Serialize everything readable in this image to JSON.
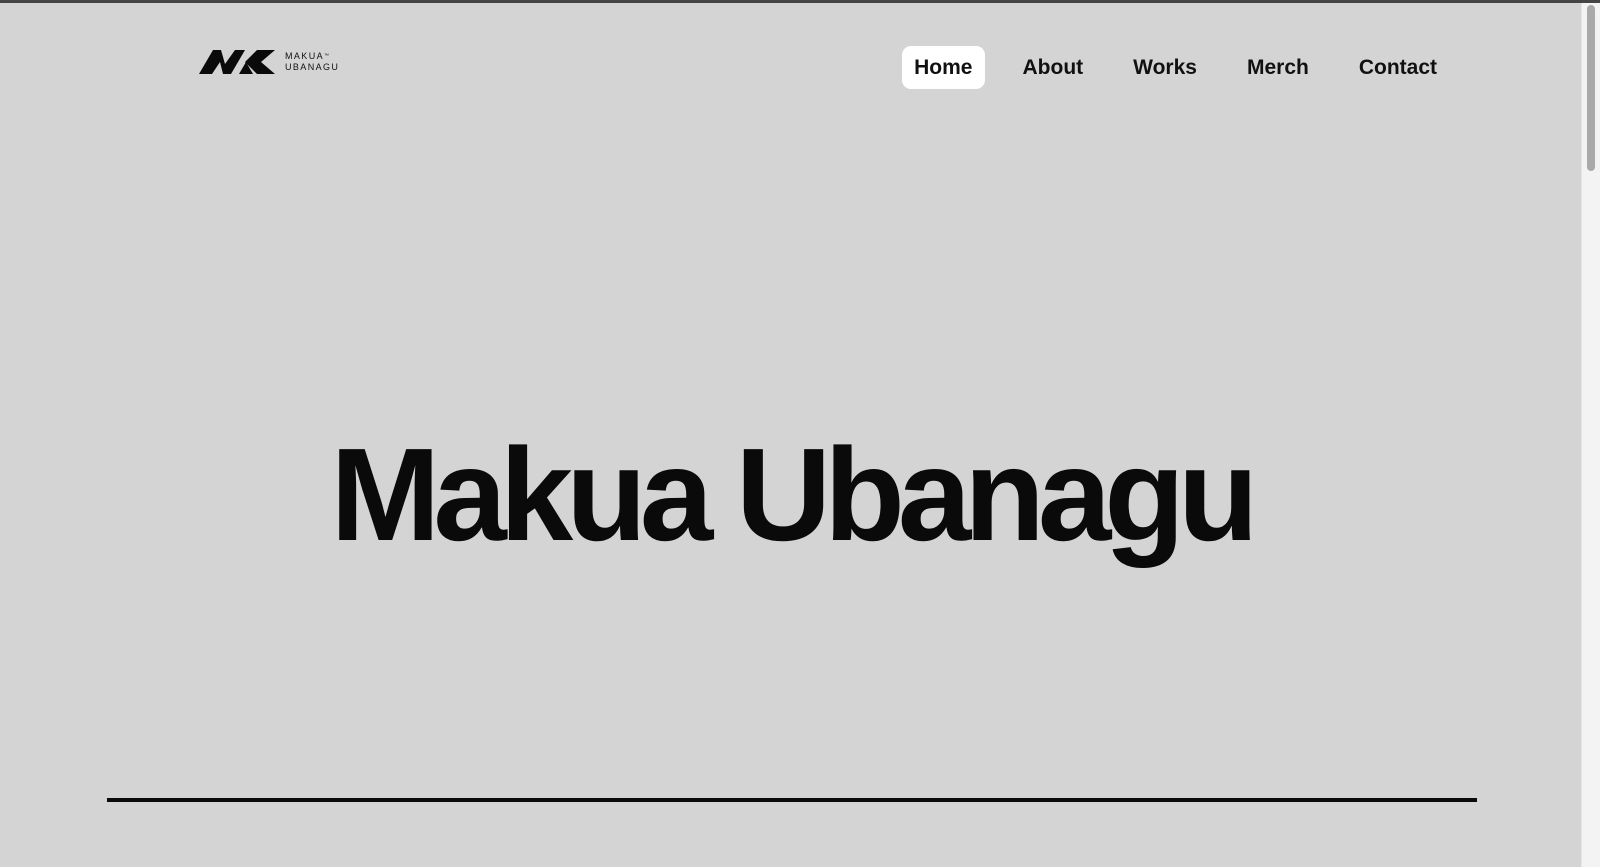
{
  "brand": {
    "mark": "MK",
    "line1": "MAKUA",
    "trademark": "™",
    "line2": "UBANAGU"
  },
  "nav": {
    "items": [
      {
        "label": "Home",
        "active": true
      },
      {
        "label": "About",
        "active": false
      },
      {
        "label": "Works",
        "active": false
      },
      {
        "label": "Merch",
        "active": false
      },
      {
        "label": "Contact",
        "active": false
      }
    ]
  },
  "hero": {
    "title": "Makua Ubanagu"
  },
  "colors": {
    "background": "#d4d4d4",
    "text": "#0a0a0a",
    "active_nav_bg": "#ffffff"
  }
}
